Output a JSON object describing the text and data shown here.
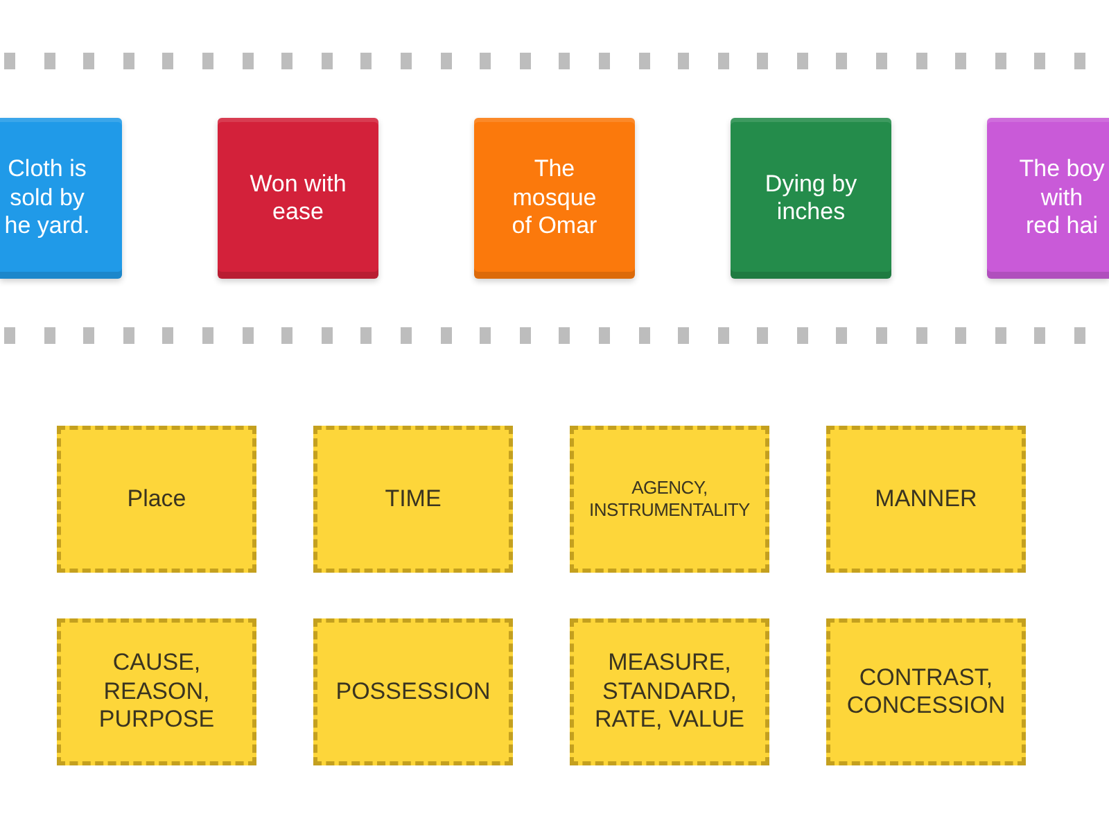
{
  "cards": [
    {
      "text": "Cloth is\nsold by\nhe yard.",
      "color": "#209ae8",
      "clipped": true
    },
    {
      "text": "Won with\nease",
      "color": "#d3213a",
      "clipped": false
    },
    {
      "text": "The\nmosque\nof Omar",
      "color": "#fb790c",
      "clipped": false
    },
    {
      "text": "Dying by\ninches",
      "color": "#248c4b",
      "clipped": false
    },
    {
      "text": "The boy\nwith\nred hai",
      "color": "#c95ad8",
      "clipped": true
    }
  ],
  "categories": [
    {
      "label": "Place"
    },
    {
      "label": "TIME"
    },
    {
      "label": "AGENCY,\nINSTRUMENTALITY"
    },
    {
      "label": "MANNER"
    },
    {
      "label": "CAUSE,\nREASON,\nPURPOSE"
    },
    {
      "label": "POSSESSION"
    },
    {
      "label": "MEASURE,\nSTANDARD,\nRATE, VALUE"
    },
    {
      "label": "CONTRAST,\nCONCESSION"
    }
  ]
}
